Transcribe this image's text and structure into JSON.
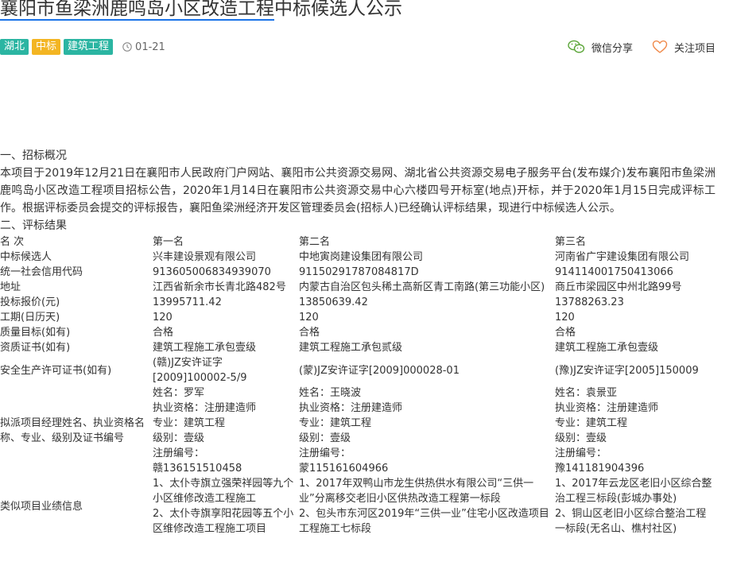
{
  "header": {
    "title_linked": "襄阳市鱼梁洲鹿鸣岛小区改造工程",
    "title_rest": "中标候选人公示",
    "tags": [
      {
        "label": "湖北",
        "color": "#2bb5a2"
      },
      {
        "label": "中标",
        "color": "#f3b523"
      },
      {
        "label": "建筑工程",
        "color": "#2bb5a2"
      }
    ],
    "date": "01-21",
    "share_label": "微信分享",
    "follow_label": "关注项目",
    "wechat_color": "#5aa537",
    "heart_color": "#f08a4b"
  },
  "content": {
    "section1_title": "一、招标概况",
    "section1_text": "本项目于2019年12月21日在襄阳市人民政府门户网站、襄阳市公共资源交易网、湖北省公共资源交易电子服务平台(发布媒介)发布襄阳市鱼梁洲鹿鸣岛小区改造工程项目招标公告，2020年1月14日在襄阳市公共资源交易中心六楼四号开标室(地点)开标，并于2020年1月15日完成评标工作。根据评标委员会提交的评标报告，襄阳鱼梁洲经济开发区管理委员会(招标人)已经确认评标结果，现进行中标候选人公示。",
    "section2_title": "二、评标结果"
  },
  "results": {
    "rank_label": "名 次",
    "ranks": [
      "第一名",
      "第二名",
      "第三名"
    ],
    "candidate_label": "中标候选人",
    "candidates": [
      "兴丰建设景观有限公司",
      "中地寅岗建设集团有限公司",
      "河南省广宇建设集团有限公司"
    ],
    "credit_label": "统一社会信用代码",
    "credit_codes": [
      "913605006834939070",
      "91150291787084817D",
      "914114001750413066"
    ],
    "address_label": "地址",
    "addresses": [
      "江西省新余市长青北路482号",
      "内蒙古自治区包头稀土高新区青工南路(第三功能小区)",
      "商丘市梁园区中州北路99号"
    ],
    "bid_label": "投标报价(元)",
    "bids": [
      "13995711.42",
      "13850639.42",
      "13788263.23"
    ],
    "period_label": "工期(日历天)",
    "periods": [
      "120",
      "120",
      "120"
    ],
    "quality_label": "质量目标(如有)",
    "qualities": [
      "合格",
      "合格",
      "合格"
    ],
    "qual_label": "资质证书(如有)",
    "quals": [
      "建筑工程施工承包壹级",
      "建筑工程施工承包贰级",
      "建筑工程施工承包壹级"
    ],
    "safety_label": "安全生产许可证书(如有)",
    "safety": [
      "(赣)JZ安许证字[2009]100002-5/9",
      "(蒙)JZ安许证字[2009]000028-01",
      "(豫)JZ安许证字[2005]150009"
    ],
    "manager_label": "拟派项目经理姓名、执业资格名称、专业、级别及证书编号",
    "managers": [
      {
        "name": "姓名：罗军",
        "cert": "执业资格：注册建造师",
        "major": "专业：建筑工程",
        "level": "级别：壹级",
        "reg_label": "注册编号：",
        "reg": "赣136151510458"
      },
      {
        "name": "姓名：王晓波",
        "cert": "执业资格：注册建造师",
        "major": "专业：建筑工程",
        "level": "级别：壹级",
        "reg_label": "注册编号：",
        "reg": "蒙115161604966"
      },
      {
        "name": "姓名：袁景亚",
        "cert": "执业资格：注册建造师",
        "major": "专业：建筑工程",
        "level": "级别：壹级",
        "reg_label": "注册编号：",
        "reg": "豫141181904396"
      }
    ],
    "perf_label": "类似项目业绩信息",
    "perfs": [
      {
        "a": "1、太仆寺旗立强荣祥园等九个小区维修改造工程施工",
        "b": "2、太仆寺旗享阳花园等五个小区维修改造工程施工项目"
      },
      {
        "a": "1、2017年双鸭山市龙生供热供水有限公司“三供一业”分离移交老旧小区供热改造工程第一标段",
        "b": "2、包头市东河区2019年“三供一业”住宅小区改造项目工程施工七标段"
      },
      {
        "a": "1、2017年云龙区老旧小区综合整治工程三标段(彭城办事处)",
        "b": "2、铜山区老旧小区综合整治工程一标段(无名山、樵村社区)"
      }
    ]
  }
}
